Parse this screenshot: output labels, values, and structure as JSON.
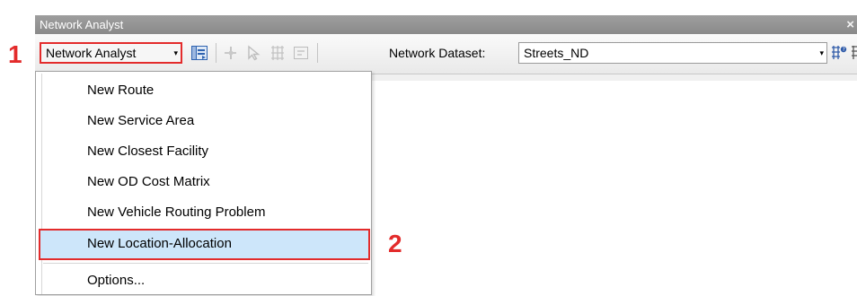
{
  "window": {
    "title": "Network Analyst",
    "close_symbol": "×"
  },
  "toolbar": {
    "network_analyst_button": "Network Analyst",
    "dropdown_arrow": "▾",
    "network_dataset_label": "Network Dataset:",
    "network_dataset_value": "Streets_ND"
  },
  "menu": {
    "items": [
      {
        "label": "New Route"
      },
      {
        "label": "New Service Area"
      },
      {
        "label": "New Closest Facility"
      },
      {
        "label": "New OD Cost Matrix"
      },
      {
        "label": "New Vehicle Routing Problem"
      },
      {
        "label": "New Location-Allocation",
        "highlighted": true
      },
      {
        "label": "Options..."
      }
    ]
  },
  "annotations": {
    "step1": "1",
    "step2": "2"
  },
  "colors": {
    "annotation_red": "#e32b2b",
    "highlight_blue": "#cde6fa"
  }
}
